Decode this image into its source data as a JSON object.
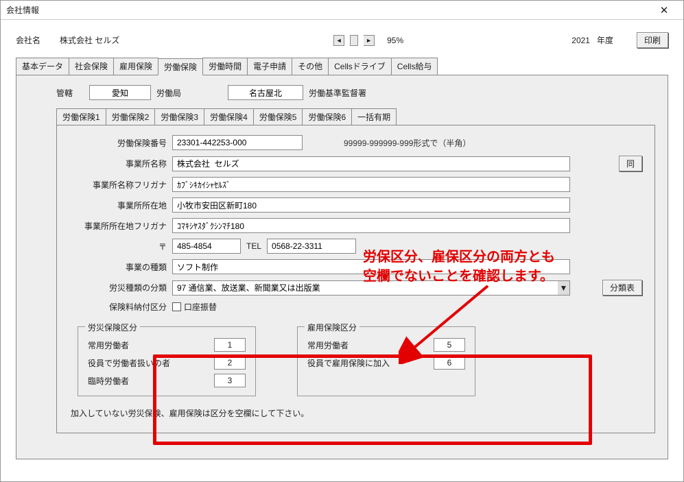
{
  "window": {
    "title": "会社情報"
  },
  "header": {
    "company_label": "会社名",
    "company_name": "株式会社 セルズ",
    "zoom": "95%",
    "year": "2021",
    "year_suffix": "年度",
    "print": "印刷"
  },
  "main_tabs": [
    "基本データ",
    "社会保険",
    "雇用保険",
    "労働保険",
    "労働時間",
    "電子申請",
    "その他",
    "Cellsドライブ",
    "Cells給与"
  ],
  "main_tab_active": 3,
  "juris": {
    "label": "管轄",
    "prefecture": "愛知",
    "bureau_suffix": "労働局",
    "office": "名古屋北",
    "office_suffix": "労働基準監督署"
  },
  "sub_tabs": [
    "労働保険1",
    "労働保険2",
    "労働保険3",
    "労働保険4",
    "労働保険5",
    "労働保険6",
    "一括有期"
  ],
  "sub_tab_active": 0,
  "form": {
    "ins_no_label": "労働保険番号",
    "ins_no": "23301-442253-000",
    "ins_no_hint": "99999-999999-999形式で（半角）",
    "office_name_label": "事業所名称",
    "office_name": "株式会社  セルズ",
    "same_btn": "同",
    "office_kana_label": "事業所名称フリガナ",
    "office_kana": "ｶﾌﾞｼｷｶｲｼｬｾﾙｽﾞ",
    "addr_label": "事業所所在地",
    "addr": "小牧市安田区新町180",
    "addr_kana_label": "事業所所在地フリガナ",
    "addr_kana": "ｺﾏｷｼﾔｽﾀﾞｸｼﾝﾏﾁ180",
    "postal_label": "〒",
    "postal": "485-4854",
    "tel_label": "TEL",
    "tel": "0568-22-3311",
    "biz_type_label": "事業の種類",
    "biz_type": "ソフト制作",
    "accident_class_label": "労災種類の分類",
    "accident_class": "97 通信業、放送業、新聞業又は出版業",
    "class_table_btn": "分類表",
    "pay_method_label": "保険料納付区分",
    "pay_method_checkbox": "口座振替"
  },
  "group_rousai": {
    "title": "労災保険区分",
    "rows": [
      {
        "label": "常用労働者",
        "value": "1"
      },
      {
        "label": "役員で労働者扱いの者",
        "value": "2"
      },
      {
        "label": "臨時労働者",
        "value": "3"
      }
    ]
  },
  "group_koyo": {
    "title": "雇用保険区分",
    "rows": [
      {
        "label": "常用労働者",
        "value": "5"
      },
      {
        "label": "役員で雇用保険に加入",
        "value": "6"
      }
    ]
  },
  "footer_note": "加入していない労災保険、雇用保険は区分を空欄にして下さい。",
  "annotation": {
    "line1": "労保区分、雇保区分の両方とも",
    "line2": "空欄でないことを確認します。"
  }
}
